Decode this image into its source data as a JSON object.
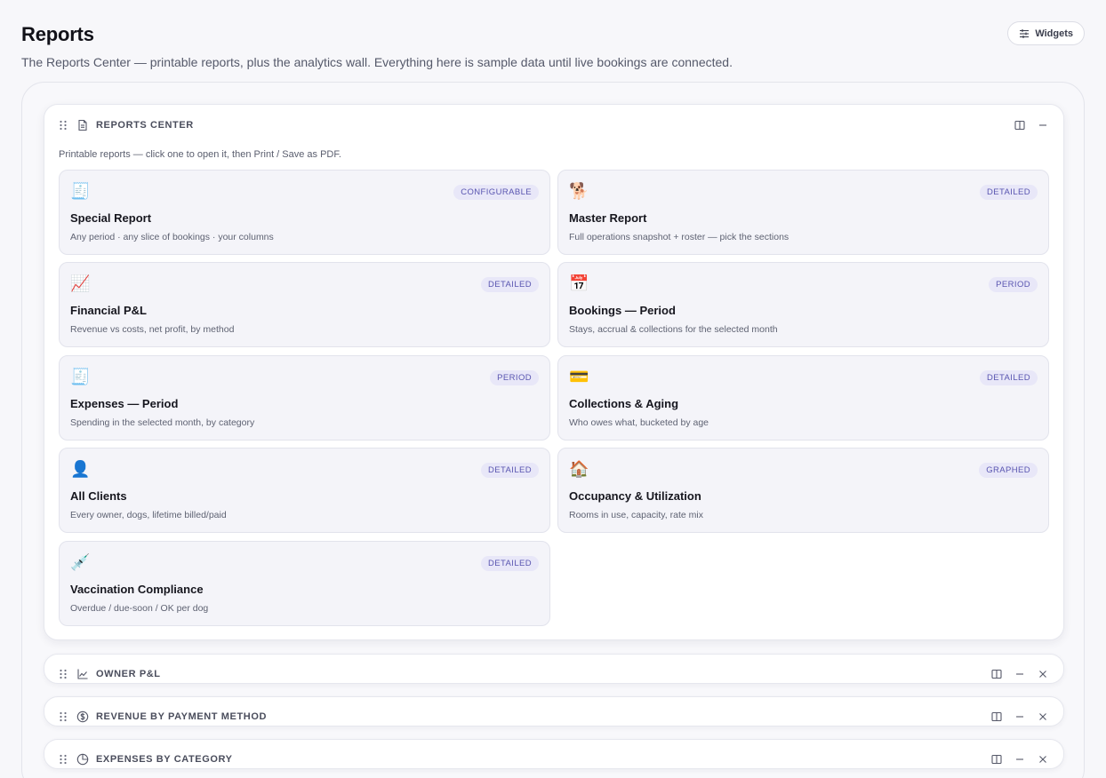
{
  "page": {
    "title": "Reports",
    "subtitle": "The Reports Center — printable reports, plus the analytics wall. Everything here is sample data until live bookings are connected.",
    "widgets_label": "Widgets"
  },
  "reports_center": {
    "title": "REPORTS CENTER",
    "description": "Printable reports — click one to open it, then Print / Save as PDF.",
    "cards": [
      {
        "emoji": "🧾",
        "badge": "CONFIGURABLE",
        "title": "Special Report",
        "desc": "Any period · any slice of bookings · your columns"
      },
      {
        "emoji": "🐕",
        "badge": "DETAILED",
        "title": "Master Report",
        "desc": "Full operations snapshot + roster — pick the sections"
      },
      {
        "emoji": "📈",
        "badge": "DETAILED",
        "title": "Financial P&L",
        "desc": "Revenue vs costs, net profit, by method"
      },
      {
        "emoji": "📅",
        "badge": "PERIOD",
        "title": "Bookings — Period",
        "desc": "Stays, accrual & collections for the selected month"
      },
      {
        "emoji": "🧾",
        "badge": "PERIOD",
        "title": "Expenses — Period",
        "desc": "Spending in the selected month, by category"
      },
      {
        "emoji": "💳",
        "badge": "DETAILED",
        "title": "Collections & Aging",
        "desc": "Who owes what, bucketed by age"
      },
      {
        "emoji": "👤",
        "badge": "DETAILED",
        "title": "All Clients",
        "desc": "Every owner, dogs, lifetime billed/paid"
      },
      {
        "emoji": "🏠",
        "badge": "GRAPHED",
        "title": "Occupancy & Utilization",
        "desc": "Rooms in use, capacity, rate mix"
      },
      {
        "emoji": "💉",
        "badge": "DETAILED",
        "title": "Vaccination Compliance",
        "desc": "Overdue / due-soon / OK per dog"
      }
    ]
  },
  "collapsed_widgets": [
    {
      "title": "OWNER P&L",
      "icon": "line-chart-icon"
    },
    {
      "title": "REVENUE BY PAYMENT METHOD",
      "icon": "dollar-circle-icon"
    },
    {
      "title": "EXPENSES BY CATEGORY",
      "icon": "pie-chart-icon"
    }
  ],
  "colors": {
    "accent": "#5955b0",
    "badge_bg": "#e8e7f8",
    "card_bg": "#f4f4f9"
  }
}
